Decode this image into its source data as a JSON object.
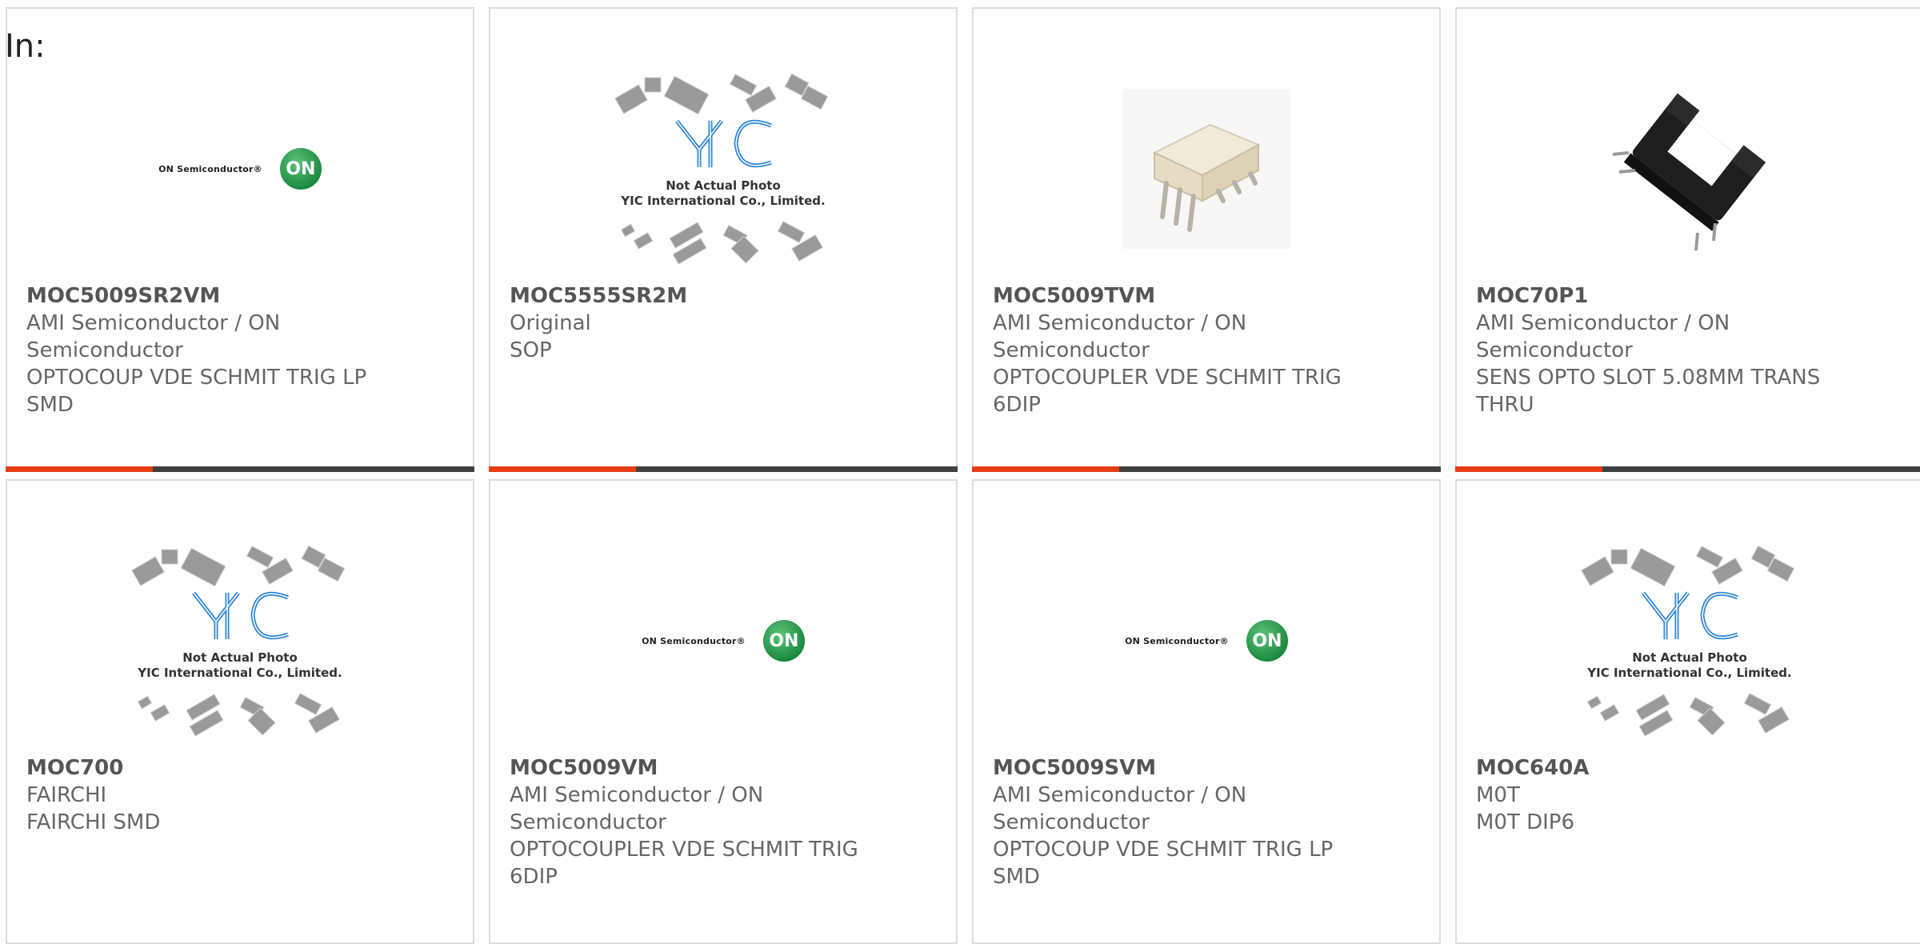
{
  "header": {
    "label": "In:"
  },
  "colors": {
    "accent": "#e63b13",
    "bar": "#404040",
    "border": "#dcdcdc"
  },
  "products": [
    {
      "part": "MOC5009SR2VM",
      "manufacturer": "AMI Semiconductor / ON Semiconductor",
      "description": "OPTOCOUP VDE SCHMIT TRIG LP SMD",
      "image": "on-semiconductor-logo"
    },
    {
      "part": "MOC5555SR2M",
      "manufacturer": "Original",
      "description": "SOP",
      "image": "yic-not-actual-photo"
    },
    {
      "part": "MOC5009TVM",
      "manufacturer": "AMI Semiconductor / ON Semiconductor",
      "description": "OPTOCOUPLER VDE SCHMIT TRIG 6DIP",
      "image": "dip6-package-photo"
    },
    {
      "part": "MOC70P1",
      "manufacturer": "AMI Semiconductor / ON Semiconductor",
      "description": "SENS OPTO SLOT 5.08MM TRANS THRU",
      "image": "slot-sensor-photo"
    },
    {
      "part": "MOC700",
      "manufacturer": "FAIRCHI",
      "description": "FAIRCHI SMD",
      "image": "yic-not-actual-photo"
    },
    {
      "part": "MOC5009VM",
      "manufacturer": "AMI Semiconductor / ON Semiconductor",
      "description": "OPTOCOUPLER VDE SCHMIT TRIG 6DIP",
      "image": "on-semiconductor-logo"
    },
    {
      "part": "MOC5009SVM",
      "manufacturer": "AMI Semiconductor / ON Semiconductor",
      "description": "OPTOCOUP VDE SCHMIT TRIG LP SMD",
      "image": "on-semiconductor-logo"
    },
    {
      "part": "MOC640A",
      "manufacturer": "M0T",
      "description": "M0T DIP6",
      "image": "yic-not-actual-photo"
    }
  ],
  "logos": {
    "on_text": "ON Semiconductor®",
    "on_mark": "ON",
    "yic_line1": "Not Actual Photo",
    "yic_line2": "YIC International Co., Limited."
  }
}
